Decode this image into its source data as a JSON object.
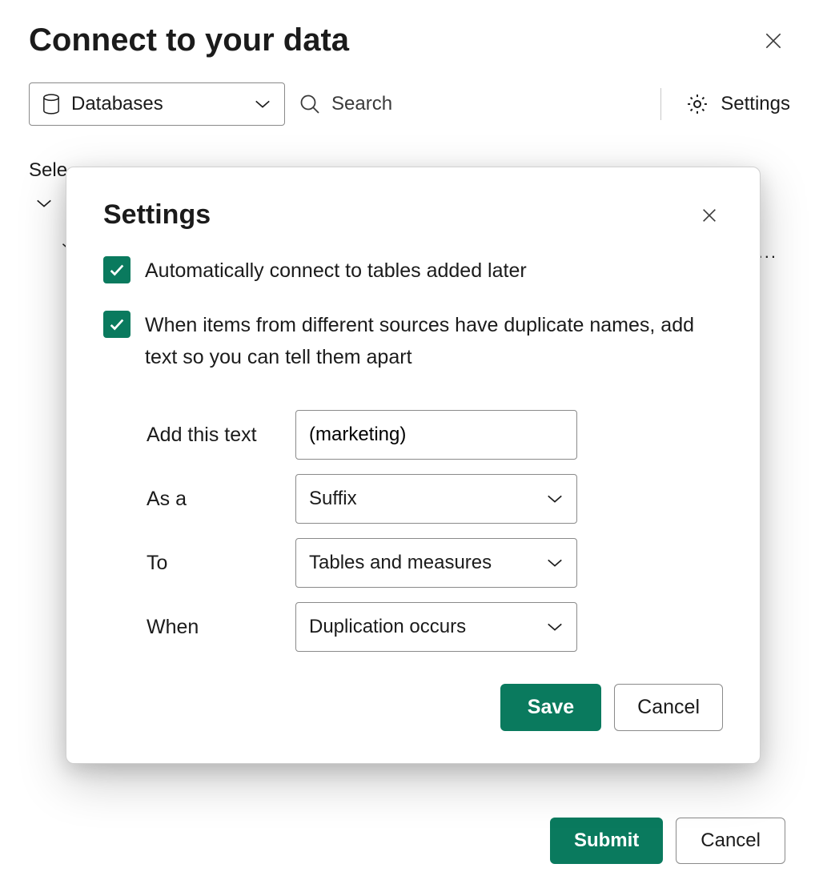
{
  "main": {
    "title": "Connect to your data",
    "source_dropdown": "Databases",
    "search_placeholder": "Search",
    "settings_button": "Settings",
    "select_label": "Sele",
    "submit_button": "Submit",
    "cancel_button": "Cancel"
  },
  "modal": {
    "title": "Settings",
    "checkbox_auto_connect": "Automatically connect to tables added later",
    "checkbox_duplicate_names": "When items from different sources have duplicate names, add text so you can tell them apart",
    "fields": {
      "add_text_label": "Add this text",
      "add_text_value": "(marketing)",
      "as_a_label": "As a",
      "as_a_value": "Suffix",
      "to_label": "To",
      "to_value": "Tables and measures",
      "when_label": "When",
      "when_value": "Duplication occurs"
    },
    "save_button": "Save",
    "cancel_button": "Cancel"
  },
  "colors": {
    "primary": "#0a7a5e"
  }
}
